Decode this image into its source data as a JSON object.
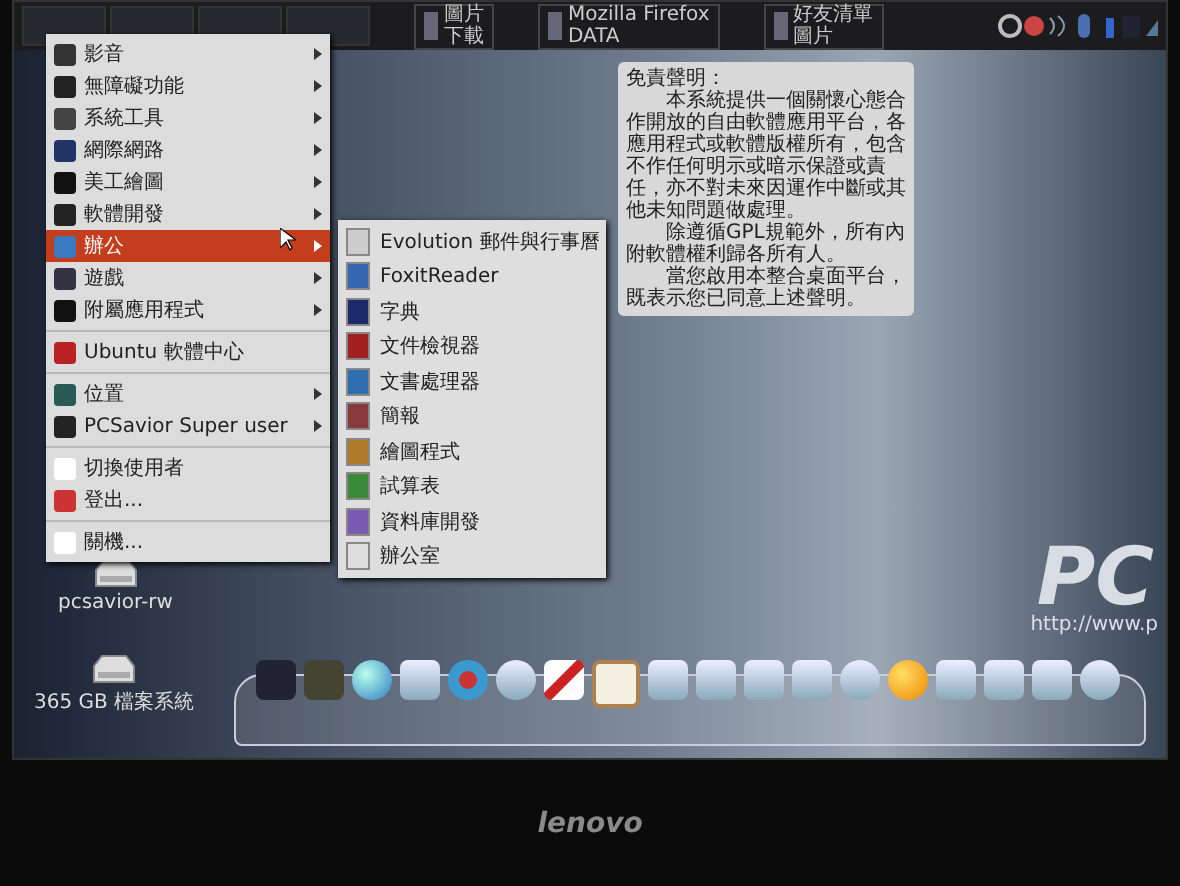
{
  "top_panel": {
    "tasks": [
      {
        "lines": [
          "圖片",
          "下載"
        ]
      },
      {
        "lines": [
          "Mozilla Firefox",
          "DATA"
        ]
      },
      {
        "lines": [
          "好友清單",
          "圖片"
        ]
      }
    ]
  },
  "main_menu": {
    "sections": [
      [
        {
          "label": "影音",
          "submenu": true,
          "selected": false
        },
        {
          "label": "無障礙功能",
          "submenu": true,
          "selected": false
        },
        {
          "label": "系統工具",
          "submenu": true,
          "selected": false
        },
        {
          "label": "網際網路",
          "submenu": true,
          "selected": false
        },
        {
          "label": "美工繪圖",
          "submenu": true,
          "selected": false
        },
        {
          "label": "軟體開發",
          "submenu": true,
          "selected": false
        },
        {
          "label": "辦公",
          "submenu": true,
          "selected": true
        },
        {
          "label": "遊戲",
          "submenu": true,
          "selected": false
        },
        {
          "label": "附屬應用程式",
          "submenu": true,
          "selected": false
        }
      ],
      [
        {
          "label": "Ubuntu 軟體中心",
          "submenu": false,
          "selected": false
        }
      ],
      [
        {
          "label": "位置",
          "submenu": true,
          "selected": false
        },
        {
          "label": "PCSavior Super user",
          "submenu": true,
          "selected": false
        }
      ],
      [
        {
          "label": "切換使用者",
          "submenu": false,
          "selected": false
        },
        {
          "label": "登出...",
          "submenu": false,
          "selected": false
        }
      ],
      [
        {
          "label": "關機...",
          "submenu": false,
          "selected": false
        }
      ]
    ]
  },
  "office_submenu": {
    "items": [
      "Evolution 郵件與行事曆",
      "FoxitReader",
      "字典",
      "文件檢視器",
      "文書處理器",
      "簡報",
      "繪圖程式",
      "試算表",
      "資料庫開發",
      "辦公室"
    ]
  },
  "disclaimer_note": {
    "title": "免責聲明：",
    "paragraphs": [
      "本系統提供一個關懷心態合作開放的自由軟體應用平台，各應用程式或軟體版權所有，包含不作任何明示或暗示保證或責任，亦不對未來因運作中斷或其他未知問題做處理。",
      "除遵循GPL規範外，所有內附軟體權利歸各所有人。",
      "當您啟用本整合桌面平台，既表示您已同意上述聲明。"
    ]
  },
  "desktop_icons": [
    {
      "label": "pcsavior-rw"
    },
    {
      "label": "365 GB 檔案系統"
    }
  ],
  "wallpaper": {
    "logo": "PC",
    "url": "http://www.p"
  },
  "bezel": {
    "brand": "lenovo"
  }
}
